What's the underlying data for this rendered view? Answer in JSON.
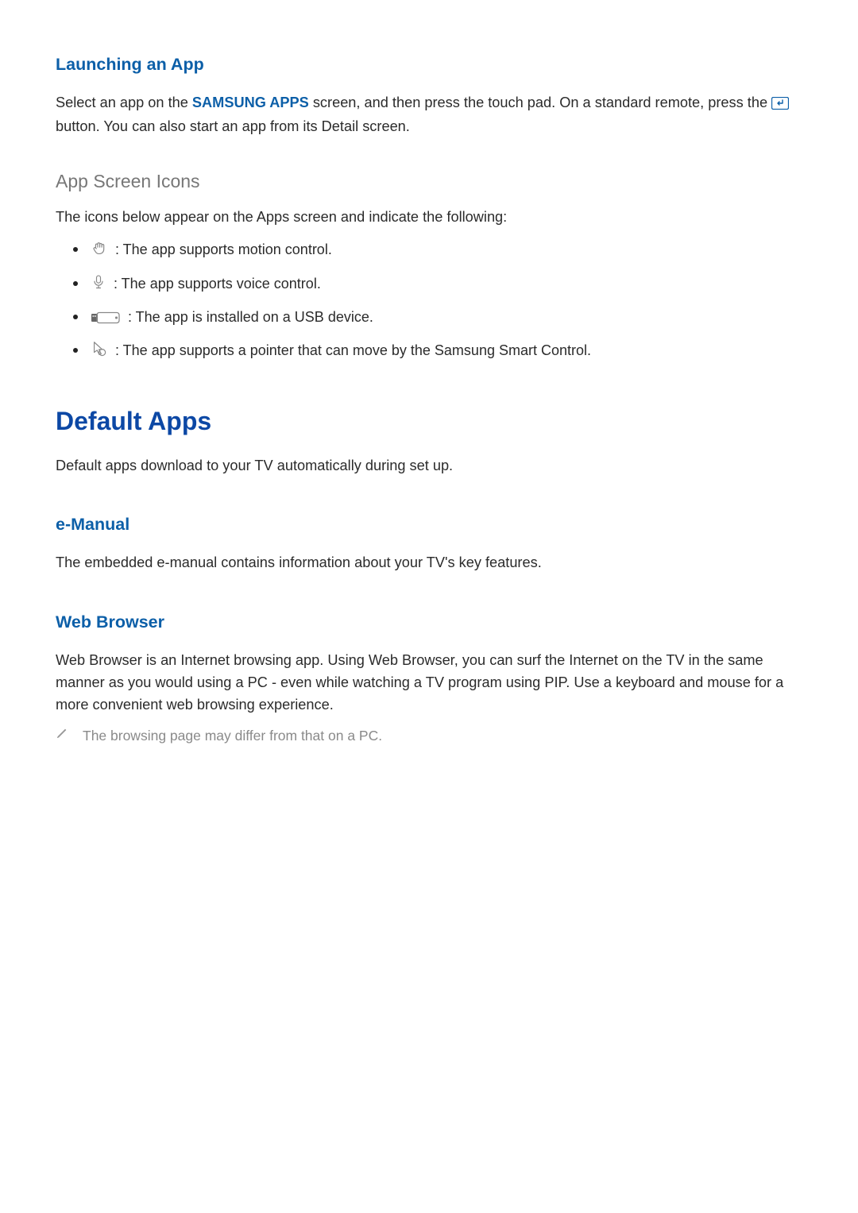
{
  "sections": {
    "launching": {
      "title": "Launching an App",
      "para_pre": "Select an app on the ",
      "strong": "SAMSUNG APPS",
      "para_mid": " screen, and then press the touch pad. On a standard remote, press the ",
      "para_post": " button. You can also start an app from its Detail screen."
    },
    "appicons": {
      "title": "App Screen Icons",
      "intro": "The icons below appear on the Apps screen and indicate the following:",
      "items": [
        " : The app supports motion control.",
        " : The app supports voice control.",
        " : The app is installed on a USB device.",
        " : The app supports a pointer that can move by the Samsung Smart Control."
      ]
    },
    "defaultapps": {
      "title": "Default Apps",
      "para": "Default apps download to your TV automatically during set up."
    },
    "emanual": {
      "title": "e-Manual",
      "para": "The embedded e-manual contains information about your TV's key features."
    },
    "webbrowser": {
      "title": "Web Browser",
      "para": "Web Browser is an Internet browsing app. Using Web Browser, you can surf the Internet on the TV in the same manner as you would using a PC - even while watching a TV program using PIP. Use a keyboard and mouse for a more convenient web browsing experience.",
      "note": "The browsing page may differ from that on a PC."
    }
  }
}
